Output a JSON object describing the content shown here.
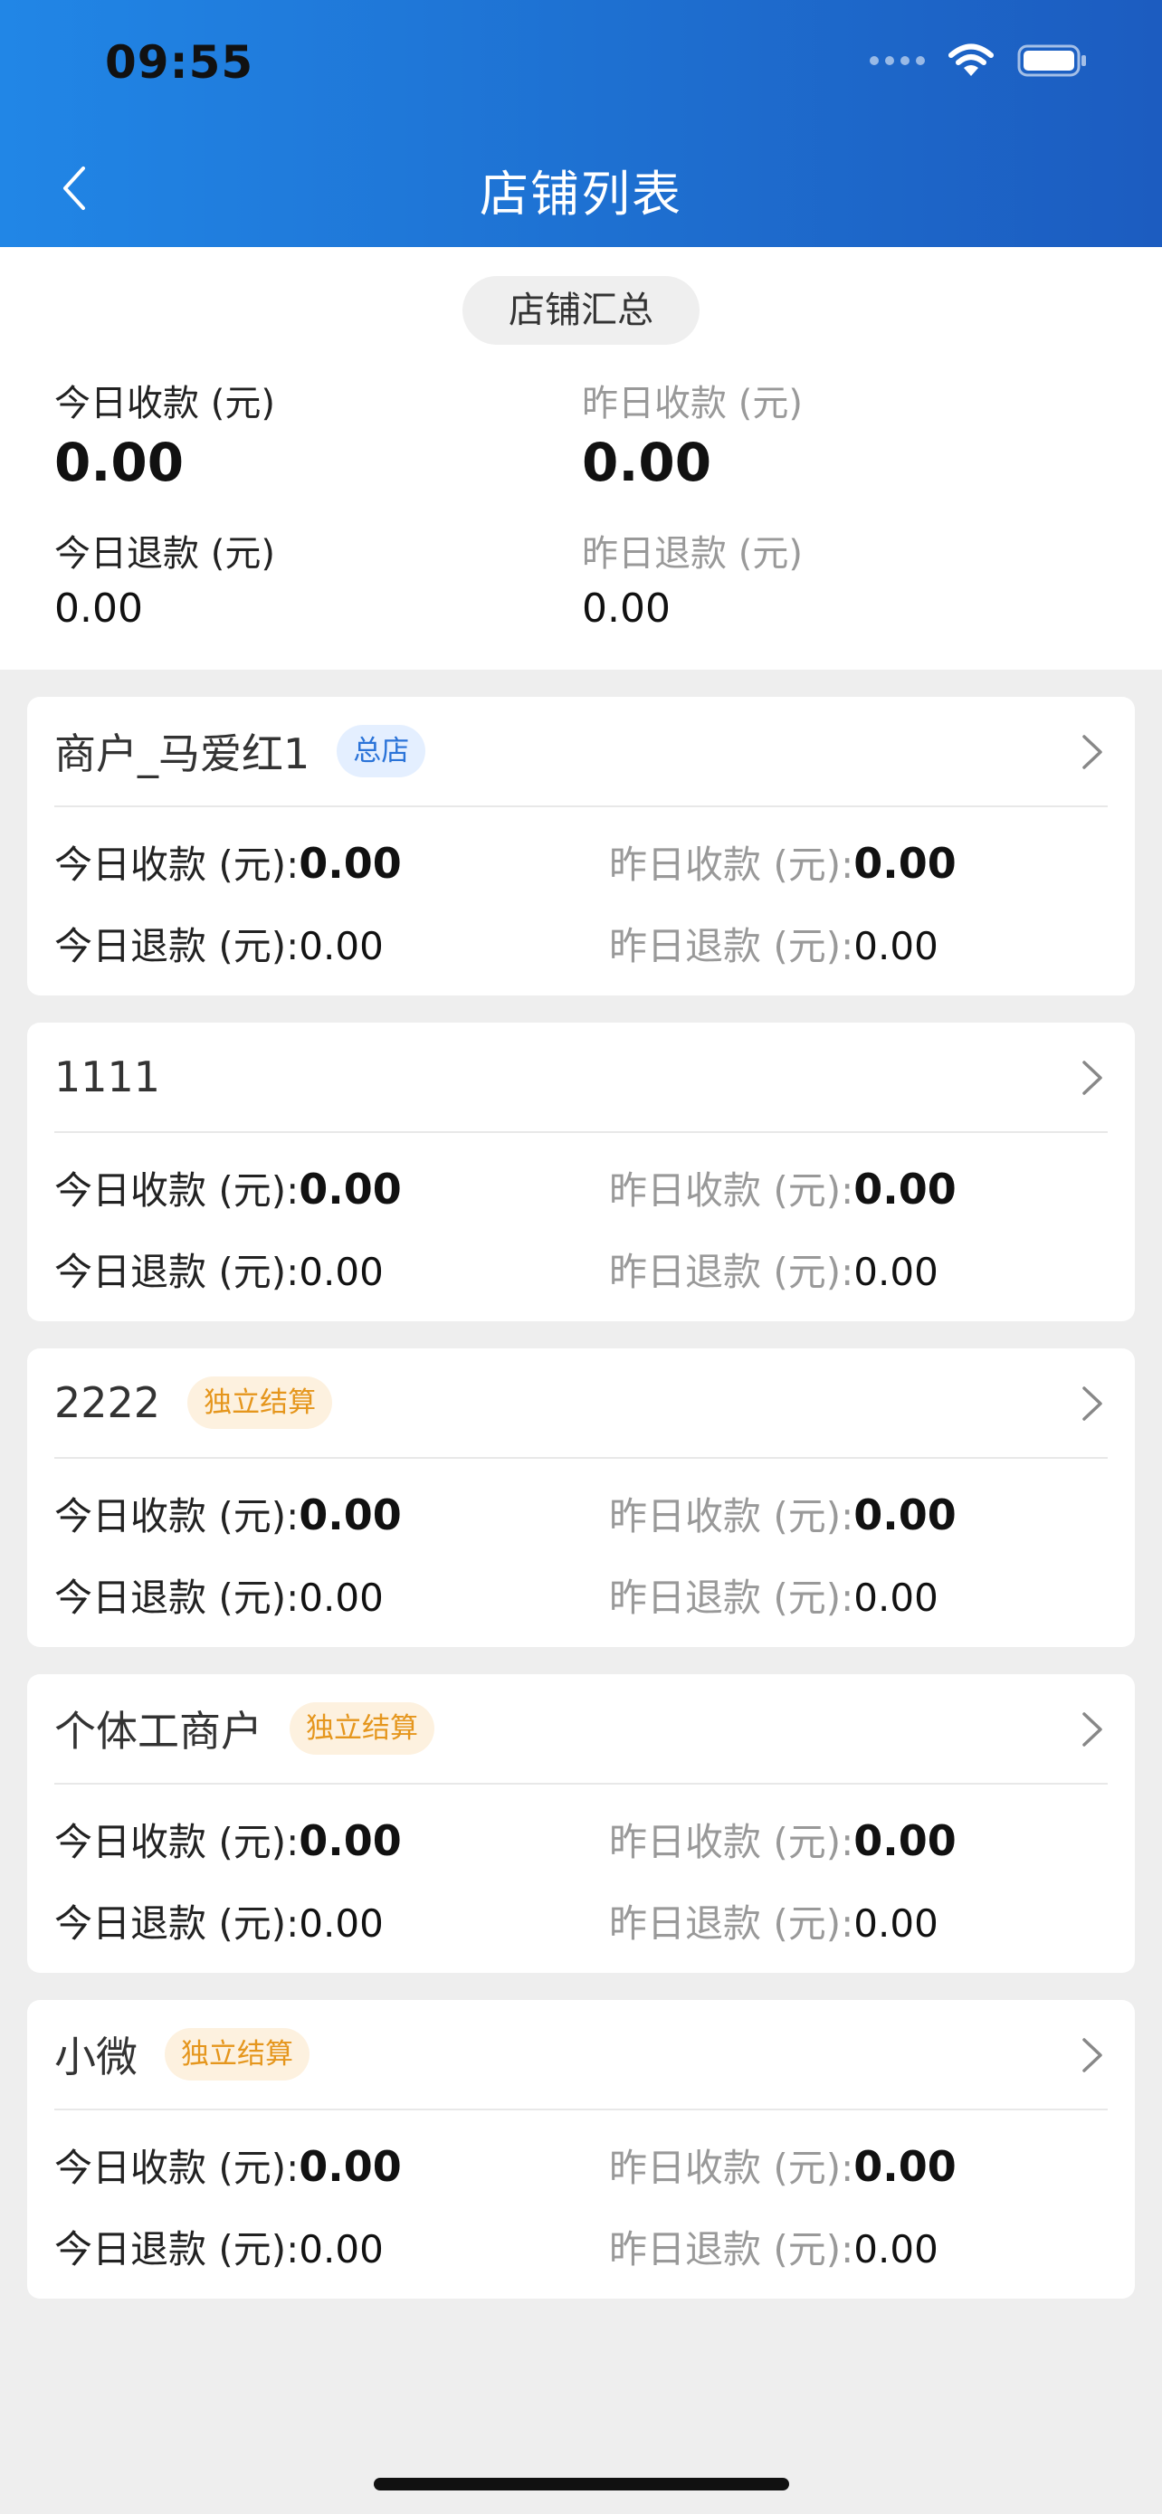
{
  "status_bar": {
    "time": "09:55"
  },
  "nav": {
    "title": "店铺列表"
  },
  "summary": {
    "pill_label": "店铺汇总",
    "today_income_label": "今日收款 (元)",
    "today_income_value": "0.00",
    "yesterday_income_label": "昨日收款 (元)",
    "yesterday_income_value": "0.00",
    "today_refund_label": "今日退款 (元)",
    "today_refund_value": "0.00",
    "yesterday_refund_label": "昨日退款 (元)",
    "yesterday_refund_value": "0.00"
  },
  "labels": {
    "today_income": "今日收款 (元):",
    "yesterday_income": "昨日收款 (元):",
    "today_refund": "今日退款 (元):",
    "yesterday_refund": "昨日退款 (元):"
  },
  "stores": [
    {
      "name": "商户_马爱红1",
      "badge": "总店",
      "today_income": "0.00",
      "yesterday_income": "0.00",
      "today_refund": "0.00",
      "yesterday_refund": "0.00"
    },
    {
      "name": "1111",
      "badge": "",
      "today_income": "0.00",
      "yesterday_income": "0.00",
      "today_refund": "0.00",
      "yesterday_refund": "0.00"
    },
    {
      "name": "2222",
      "badge": "独立结算",
      "today_income": "0.00",
      "yesterday_income": "0.00",
      "today_refund": "0.00",
      "yesterday_refund": "0.00"
    },
    {
      "name": "个体工商户",
      "badge": "独立结算",
      "today_income": "0.00",
      "yesterday_income": "0.00",
      "today_refund": "0.00",
      "yesterday_refund": "0.00"
    },
    {
      "name": "小微",
      "badge": "独立结算",
      "today_income": "0.00",
      "yesterday_income": "0.00",
      "today_refund": "0.00",
      "yesterday_refund": "0.00"
    }
  ],
  "colors": {
    "header_start": "#2186e6",
    "header_end": "#1c5cc0",
    "badge_blue": "#2a73d8",
    "badge_orange": "#e5961d"
  }
}
